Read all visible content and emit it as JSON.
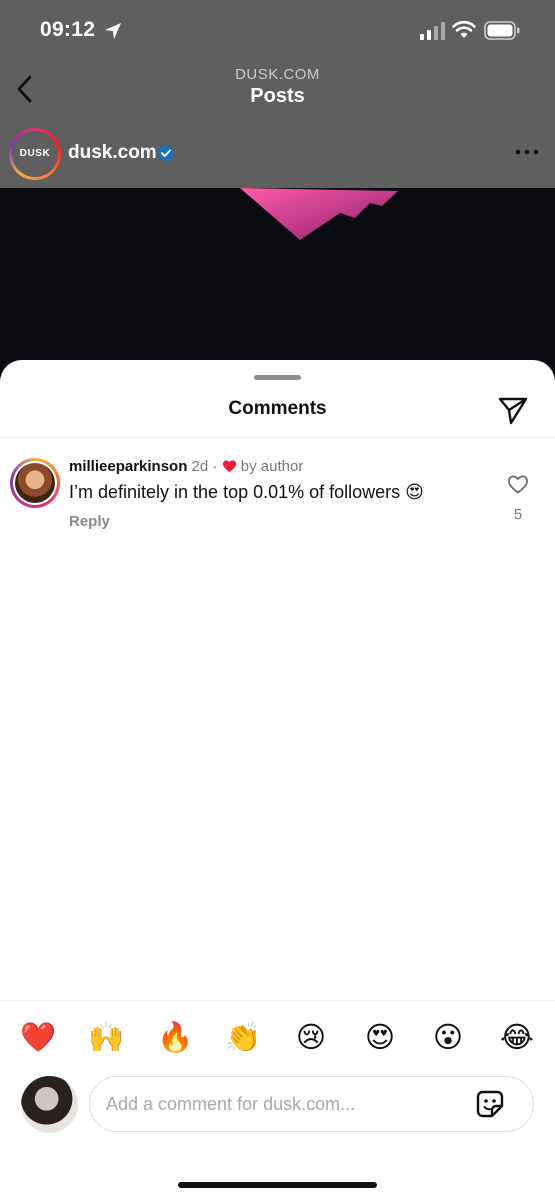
{
  "status_bar": {
    "time": "09:12"
  },
  "nav": {
    "subtitle": "DUSK.COM",
    "title": "Posts"
  },
  "account": {
    "avatar_text": "DUSK",
    "name": "dusk.com"
  },
  "sheet": {
    "title": "Comments"
  },
  "comment": {
    "username": "millieeparkinson",
    "age": "2d",
    "separator": "·",
    "liked_by": "by author",
    "text": "I’m definitely in the top 0.01% of followers 😍",
    "reply_label": "Reply",
    "like_count": "5"
  },
  "quick_reactions": [
    "❤️",
    "🙌",
    "🔥",
    "👏",
    "😢",
    "😍",
    "😮",
    "😂"
  ],
  "composer": {
    "placeholder": "Add a comment for dusk.com..."
  },
  "colors": {
    "accent_red": "#ed1c3a",
    "verified_blue": "#1d9bf0",
    "sheet_bg": "#ffffff",
    "dim_bg": "#5f5f5f"
  },
  "icons": [
    "location-arrow-icon",
    "signal-icon",
    "wifi-icon",
    "battery-icon",
    "back-chevron-icon",
    "verified-badge-icon",
    "more-dots-icon",
    "paper-plane-icon",
    "heart-icon",
    "sticker-icon"
  ]
}
